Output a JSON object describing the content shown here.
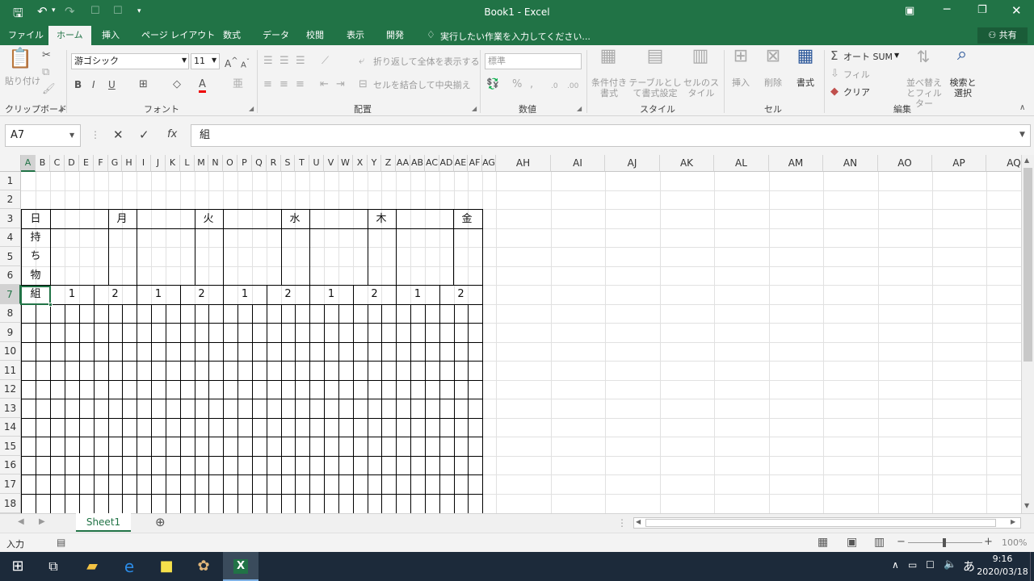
{
  "title": "Book1 - Excel",
  "tabs": [
    "ファイル",
    "ホーム",
    "挿入",
    "ページ レイアウト",
    "数式",
    "データ",
    "校閲",
    "表示",
    "開発"
  ],
  "active_tab": "ホーム",
  "tell_me": "実行したい作業を入力してください...",
  "share_label": "共有",
  "ribbon": {
    "clipboard": {
      "label": "クリップボード",
      "paste": "貼り付け"
    },
    "font": {
      "label": "フォント",
      "name": "游ゴシック",
      "size": "11"
    },
    "alignment": {
      "label": "配置",
      "wrap_text": "折り返して全体を表示する",
      "merge_center": "セルを結合して中央揃え"
    },
    "number": {
      "label": "数値",
      "format": "標準"
    },
    "styles": {
      "label": "スタイル",
      "conditional": "条件付き書式",
      "table": "テーブルとして書式設定",
      "cell_styles": "セルのスタイル"
    },
    "cells": {
      "label": "セル",
      "insert": "挿入",
      "delete": "削除",
      "format": "書式"
    },
    "editing": {
      "label": "編集",
      "autosum": "オート SUM",
      "fill": "フィル",
      "clear": "クリア",
      "sort_filter": "並べ替えとフィルター",
      "find_select": "検索と選択"
    }
  },
  "name_box": "A7",
  "formula": "組",
  "columns": [
    "A",
    "B",
    "C",
    "D",
    "E",
    "F",
    "G",
    "H",
    "I",
    "J",
    "K",
    "L",
    "M",
    "N",
    "O",
    "P",
    "Q",
    "R",
    "S",
    "T",
    "U",
    "V",
    "W",
    "X",
    "Y",
    "Z",
    "AA",
    "AB",
    "AC",
    "AD",
    "AE",
    "AF",
    "AG",
    "AH",
    "AI",
    "AJ",
    "AK",
    "AL",
    "AM",
    "AN",
    "AO",
    "AP",
    "AQ"
  ],
  "rows": [
    "1",
    "2",
    "3",
    "4",
    "5",
    "6",
    "7",
    "8",
    "9",
    "10",
    "11",
    "12",
    "13",
    "14",
    "15",
    "16",
    "17",
    "18"
  ],
  "cells": {
    "days": [
      "日",
      "月",
      "火",
      "水",
      "木",
      "金"
    ],
    "belongings": [
      "持",
      "ち",
      "物"
    ],
    "a7": "組",
    "groups": [
      "1",
      "2",
      "1",
      "2",
      "1",
      "2",
      "1",
      "2",
      "1",
      "2"
    ]
  },
  "sheet_tab": "Sheet1",
  "status": {
    "mode": "入力",
    "zoom": "100%"
  },
  "clock": {
    "time": "9:16",
    "date": "2020/03/18"
  },
  "ime": "あ",
  "colors": {
    "accent": "#217346",
    "taskbar": "#1c2a3a"
  }
}
